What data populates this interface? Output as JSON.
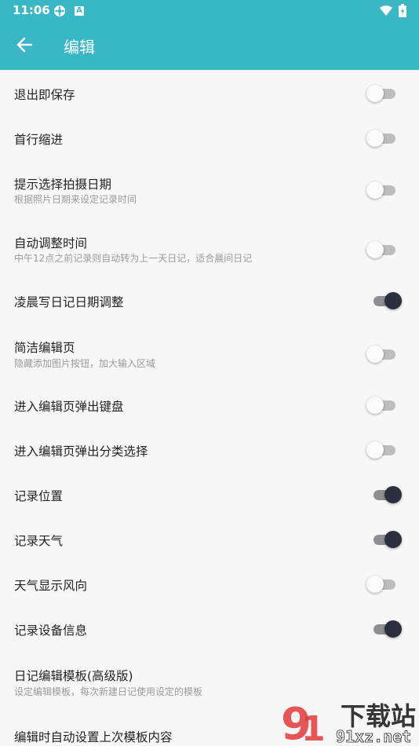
{
  "status_bar": {
    "time": "11:06",
    "icons": [
      "settings-gear-icon",
      "a-notification-icon",
      "wifi-icon",
      "battery-icon"
    ]
  },
  "app_bar": {
    "title": "编辑",
    "back_icon": "arrow-back-icon",
    "color": "#3ab7c4"
  },
  "settings": [
    {
      "label": "退出即保存",
      "sub": "",
      "on": false
    },
    {
      "label": "首行缩进",
      "sub": "",
      "on": false
    },
    {
      "label": "提示选择拍摄日期",
      "sub": "根据照片日期来设定记录时间",
      "on": false
    },
    {
      "label": "自动调整时间",
      "sub": "中午12点之前记录则自动转为上一天日记，适合晨间日记",
      "on": false
    },
    {
      "label": "凌晨写日记日期调整",
      "sub": "",
      "on": true
    },
    {
      "label": "简洁编辑页",
      "sub": "隐藏添加图片按钮，加大输入区域",
      "on": false
    },
    {
      "label": "进入编辑页弹出键盘",
      "sub": "",
      "on": false
    },
    {
      "label": "进入编辑页弹出分类选择",
      "sub": "",
      "on": false
    },
    {
      "label": "记录位置",
      "sub": "",
      "on": true
    },
    {
      "label": "记录天气",
      "sub": "",
      "on": true
    },
    {
      "label": "天气显示风向",
      "sub": "",
      "on": false
    },
    {
      "label": "记录设备信息",
      "sub": "",
      "on": true
    },
    {
      "label": "日记编辑模板(高级版)",
      "sub": "设定编辑模板，每次新建日记使用设定的模板",
      "on": null
    },
    {
      "label": "编辑时自动设置上次模板内容",
      "sub": "",
      "on": null
    }
  ],
  "watermark": {
    "line1": "下载站",
    "line2": "91xz.net"
  }
}
